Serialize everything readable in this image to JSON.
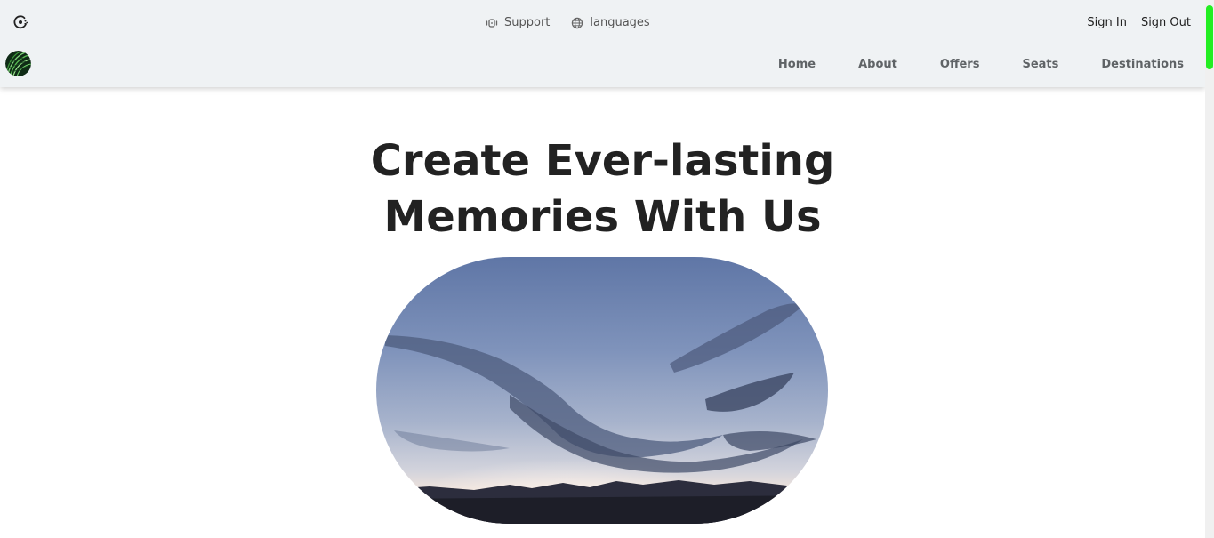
{
  "header": {
    "top_icon": "cookie-settings-icon",
    "top_links": [
      {
        "label": "Support",
        "icon": "headset-icon"
      },
      {
        "label": "languages",
        "icon": "globe-icon"
      }
    ],
    "auth": {
      "sign_in": "Sign In",
      "sign_out": "Sign Out"
    },
    "logo_icon": "palm-leaf-logo-icon",
    "nav": [
      "Home",
      "About",
      "Offers",
      "Seats",
      "Destinations"
    ]
  },
  "hero": {
    "title_line1": "Create Ever-lasting",
    "title_line2": "Memories With Us",
    "image_icon": "sky-landscape-image"
  },
  "colors": {
    "header_bg": "#eff2f4",
    "scroll_thumb": "#22ee22",
    "nav_text": "#5f6366"
  }
}
